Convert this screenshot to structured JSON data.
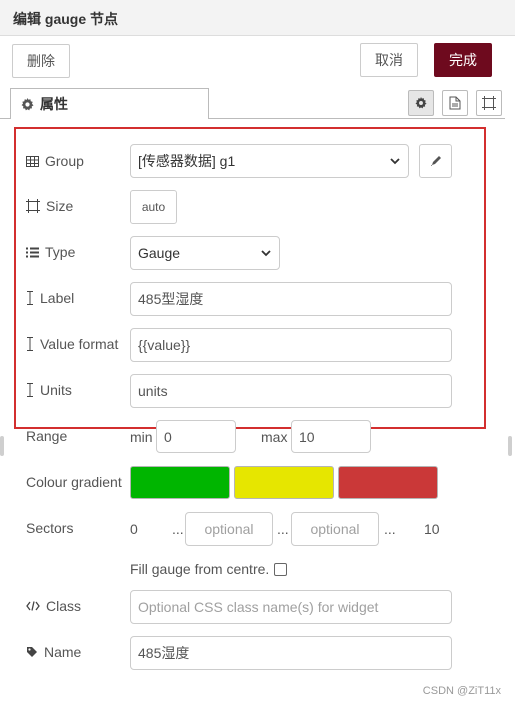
{
  "header": {
    "title": "编辑 gauge 节点"
  },
  "toolbar": {
    "delete_label": "删除",
    "cancel_label": "取消",
    "done_label": "完成"
  },
  "tabs": {
    "properties_label": "属性"
  },
  "form": {
    "group": {
      "label": "Group",
      "value": "[传感器数据] g1"
    },
    "size": {
      "label": "Size",
      "value": "auto"
    },
    "type": {
      "label": "Type",
      "value": "Gauge"
    },
    "label_field": {
      "label": "Label",
      "value": "485型湿度"
    },
    "value_format": {
      "label": "Value format",
      "value": "{{value}}"
    },
    "units": {
      "label": "Units",
      "value": "units"
    },
    "range": {
      "label": "Range",
      "min_label": "min",
      "min_value": "0",
      "max_label": "max",
      "max_value": "10"
    },
    "colour_gradient": {
      "label": "Colour gradient",
      "colors": [
        "#00b500",
        "#e6e600",
        "#ca3838"
      ]
    },
    "sectors": {
      "label": "Sectors",
      "start": "0",
      "dots": "...",
      "placeholder": "optional",
      "end": "10"
    },
    "fill_gauge": {
      "label": "Fill gauge from centre."
    },
    "class": {
      "label": "Class",
      "placeholder": "Optional CSS class name(s) for widget"
    },
    "name": {
      "label": "Name",
      "value": "485湿度"
    }
  },
  "watermark": "CSDN @ZiT11x"
}
